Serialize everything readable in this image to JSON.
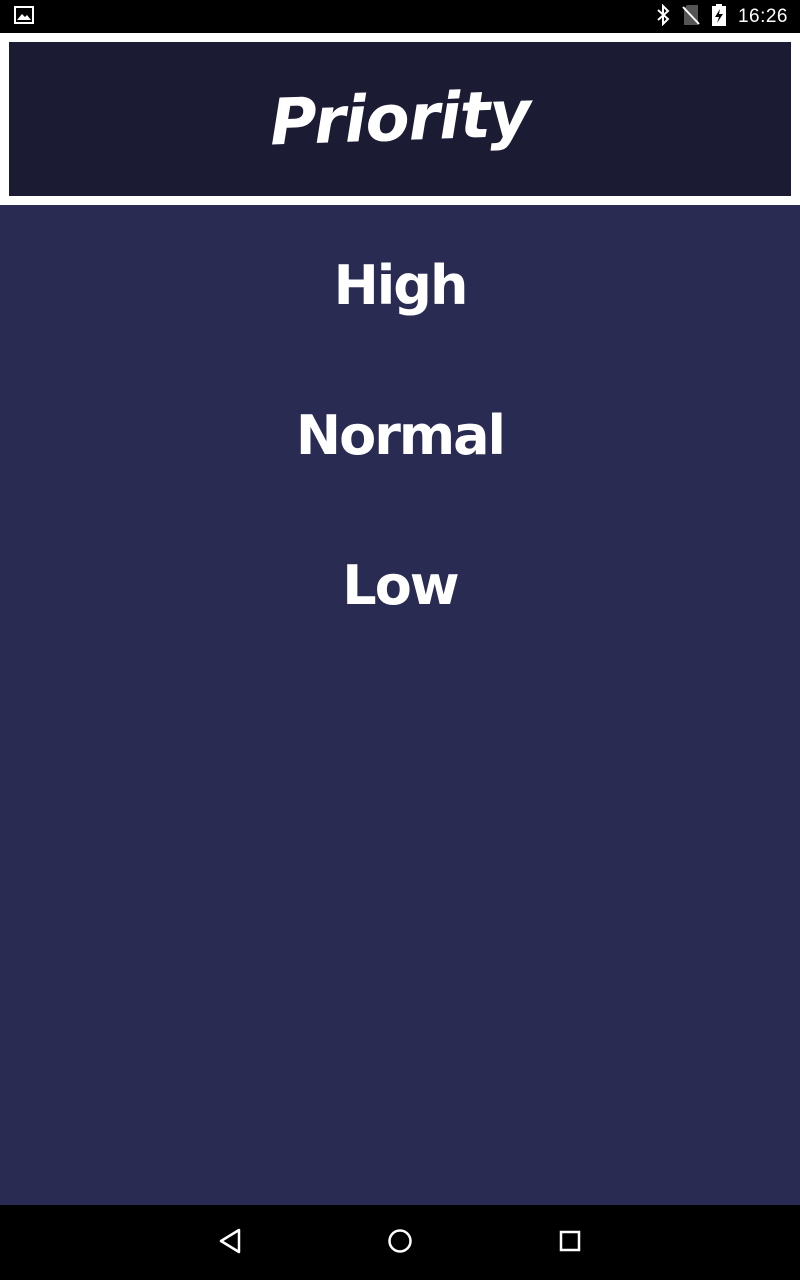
{
  "status_bar": {
    "time": "16:26",
    "icons": [
      "image-notification-icon",
      "bluetooth-icon",
      "no-sim-icon",
      "battery-charging-icon"
    ]
  },
  "header": {
    "title": "Priority"
  },
  "options": [
    {
      "label": "High"
    },
    {
      "label": "Normal"
    },
    {
      "label": "Low"
    }
  ],
  "nav": {
    "icons": [
      "back-icon",
      "home-icon",
      "recents-icon"
    ]
  },
  "colors": {
    "header_bg": "#1b1b34",
    "main_bg": "#292b53",
    "text": "#ffffff"
  }
}
